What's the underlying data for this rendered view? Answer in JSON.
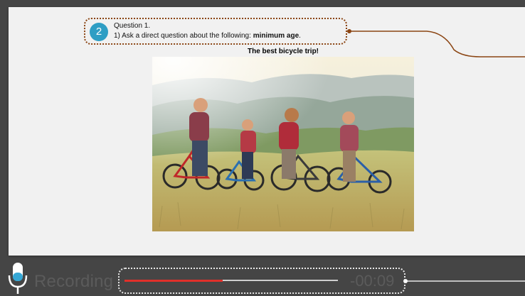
{
  "question": {
    "number": "2",
    "title": "Question 1.",
    "prompt_prefix": "1) Ask a direct question about the following: ",
    "prompt_bold": "minimum age",
    "prompt_suffix": "."
  },
  "photo": {
    "title": "The best bicycle trip!"
  },
  "recorder": {
    "label": "Recording",
    "timer": "-00:09",
    "progress_fraction": 0.46
  },
  "colors": {
    "accent_badge": "#2e9ec4",
    "callout_brown": "#8b4513",
    "progress_red": "#e0302a"
  },
  "icons": {
    "microphone": "microphone-icon"
  }
}
